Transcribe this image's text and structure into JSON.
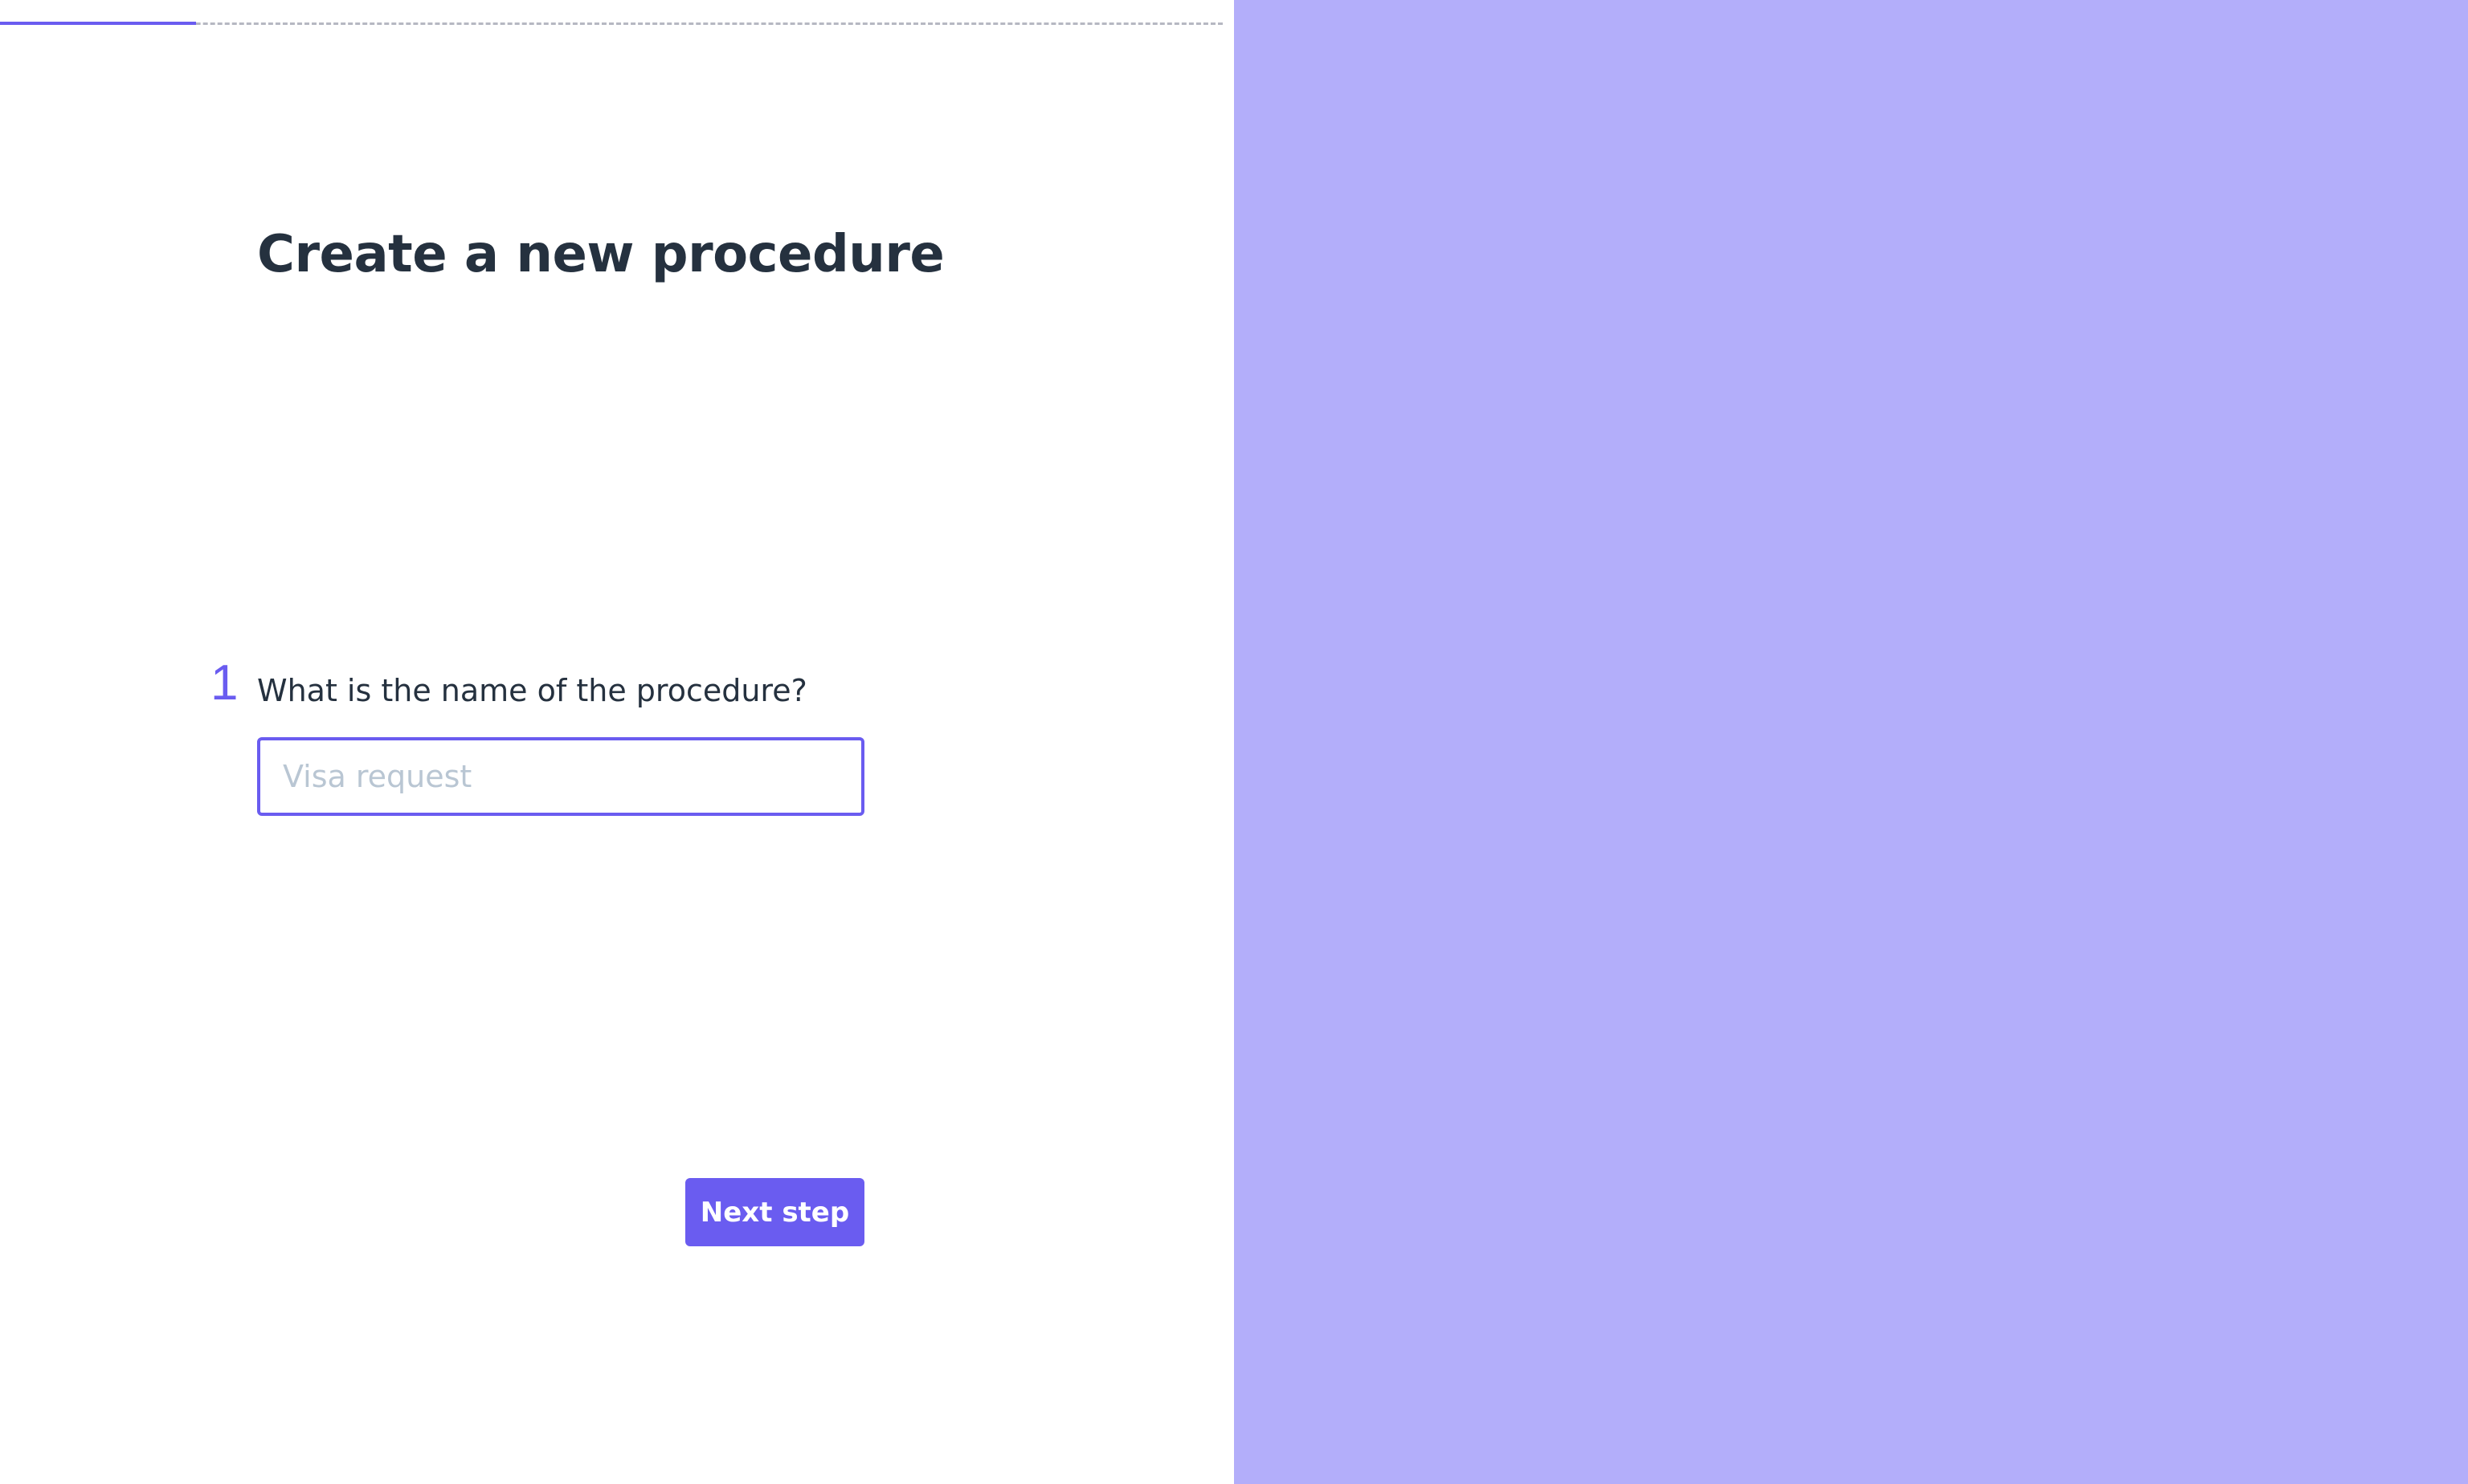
{
  "progress": {
    "fraction": 0.16,
    "fill_color": "#6a5cf0",
    "track_color": "#b6b8c2"
  },
  "page": {
    "title": "Create a new procedure"
  },
  "question": {
    "number": "1",
    "label": "What is the name of the procedure?",
    "input_placeholder": "Visa request",
    "input_value": ""
  },
  "actions": {
    "next_label": "Next step"
  },
  "colors": {
    "accent": "#6a5cf0",
    "side_panel": "#b3aefa",
    "text": "#25313f"
  }
}
